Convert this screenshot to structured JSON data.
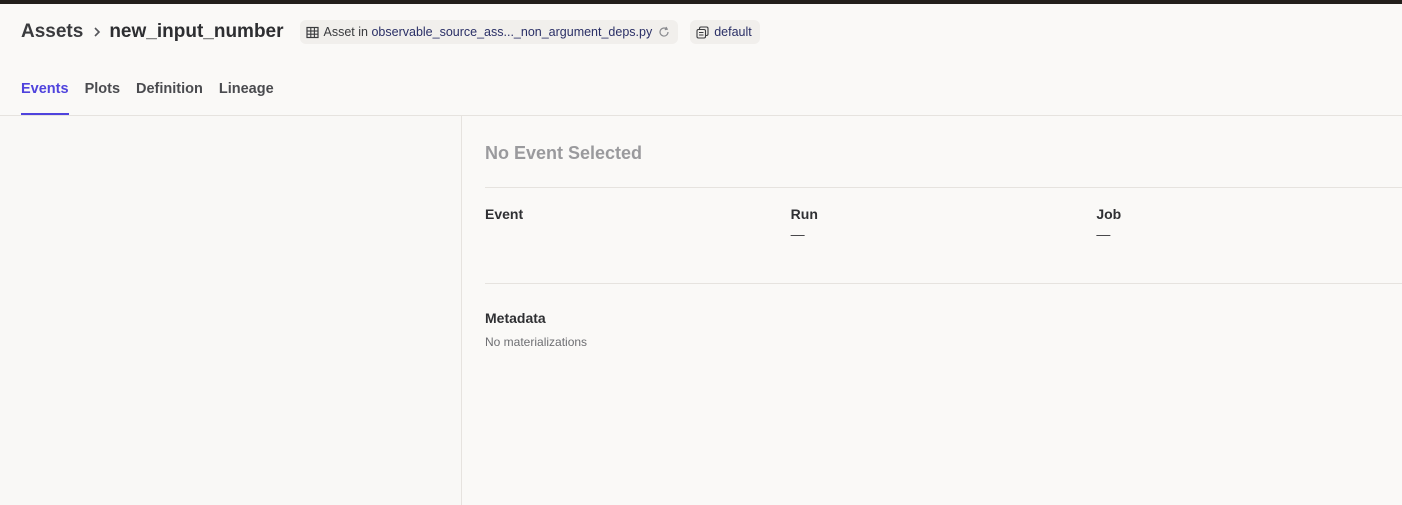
{
  "breadcrumb": {
    "root": "Assets",
    "current": "new_input_number"
  },
  "asset_tag": {
    "prefix": "Asset in",
    "location": "observable_source_ass..._non_argument_deps.py"
  },
  "group_tag": {
    "label": "default"
  },
  "tabs": [
    {
      "label": "Events",
      "active": true
    },
    {
      "label": "Plots",
      "active": false
    },
    {
      "label": "Definition",
      "active": false
    },
    {
      "label": "Lineage",
      "active": false
    }
  ],
  "detail": {
    "empty_title": "No Event Selected",
    "columns": [
      {
        "header": "Event",
        "value": ""
      },
      {
        "header": "Run",
        "value": "—"
      },
      {
        "header": "Job",
        "value": "—"
      }
    ],
    "metadata_title": "Metadata",
    "metadata_empty": "No materializations"
  },
  "icons": {
    "breadcrumb_sep": "chevron-right-icon",
    "asset": "table-icon",
    "reload": "refresh-icon",
    "group": "asset-group-icon"
  },
  "colors": {
    "accent": "#4F43DD",
    "link": "#2A2F66"
  }
}
